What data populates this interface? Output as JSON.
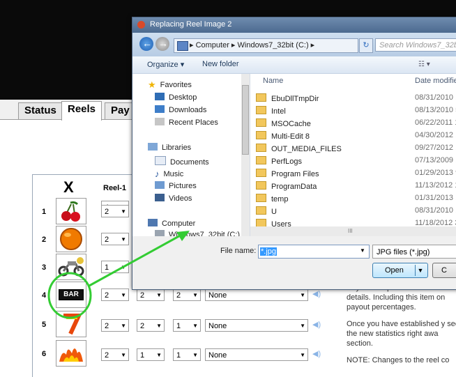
{
  "dialog": {
    "title": "Replacing Reel Image 2",
    "address": "▸ Computer ▸ Windows7_32bit (C:) ▸",
    "search_placeholder": "Search Windows7_32bit",
    "toolbar": {
      "organize": "Organize ▾",
      "new_folder": "New folder"
    },
    "nav": {
      "favorites": "Favorites",
      "favorites_items": [
        "Desktop",
        "Downloads",
        "Recent Places"
      ],
      "libraries": "Libraries",
      "libraries_items": [
        "Documents",
        "Music",
        "Pictures",
        "Videos"
      ],
      "computer": "Computer",
      "computer_items": [
        "Windows7_32bit (C:)"
      ]
    },
    "columns": {
      "name": "Name",
      "date": "Date modifie"
    },
    "files": [
      {
        "name": "EbuDllTmpDir",
        "date": "08/31/2010 1"
      },
      {
        "name": "Intel",
        "date": "08/13/2010 5"
      },
      {
        "name": "MSOCache",
        "date": "06/22/2011 1"
      },
      {
        "name": "Multi-Edit 8",
        "date": "04/30/2012 1"
      },
      {
        "name": "OUT_MEDIA_FILES",
        "date": "09/27/2012 1"
      },
      {
        "name": "PerfLogs",
        "date": "07/13/2009 1"
      },
      {
        "name": "Program Files",
        "date": "01/29/2013 9"
      },
      {
        "name": "ProgramData",
        "date": "11/13/2012 1"
      },
      {
        "name": "temp",
        "date": "01/31/2013 1"
      },
      {
        "name": "U",
        "date": "08/31/2010 1"
      },
      {
        "name": "Users",
        "date": "11/18/2012 3"
      }
    ],
    "scroll_marker": "III",
    "file_name_label": "File name:",
    "file_name_value": "*.jpg",
    "file_type": "JPG files (*.jpg)",
    "open_label": "Open",
    "cancel_label": "C"
  },
  "app": {
    "tabs": [
      "Status",
      "Reels",
      "Pay"
    ],
    "reel_header": "Reel-1",
    "x_label": "X",
    "x_row_value": "4",
    "rows": [
      {
        "num": "1",
        "symbol": "cherry",
        "r1": "2"
      },
      {
        "num": "2",
        "symbol": "orange",
        "r1": "2"
      },
      {
        "num": "3",
        "symbol": "motorcycle",
        "r1": "1"
      },
      {
        "num": "4",
        "symbol": "bar",
        "r1": "2",
        "r2": "2",
        "r3": "2",
        "sound": "None"
      },
      {
        "num": "5",
        "symbol": "seven",
        "r1": "2",
        "r2": "2",
        "r3": "1",
        "sound": "None"
      },
      {
        "num": "6",
        "symbol": "flames",
        "r1": "2",
        "r2": "1",
        "r3": "1",
        "sound": "None"
      }
    ],
    "bar_text": "BAR",
    "right_text": [
      "PayLine sequence. Please s details. Including this item on payout percentages.",
      "Once you have established y see the new statistics right awa section.",
      "NOTE: Changes to the reel co"
    ]
  }
}
